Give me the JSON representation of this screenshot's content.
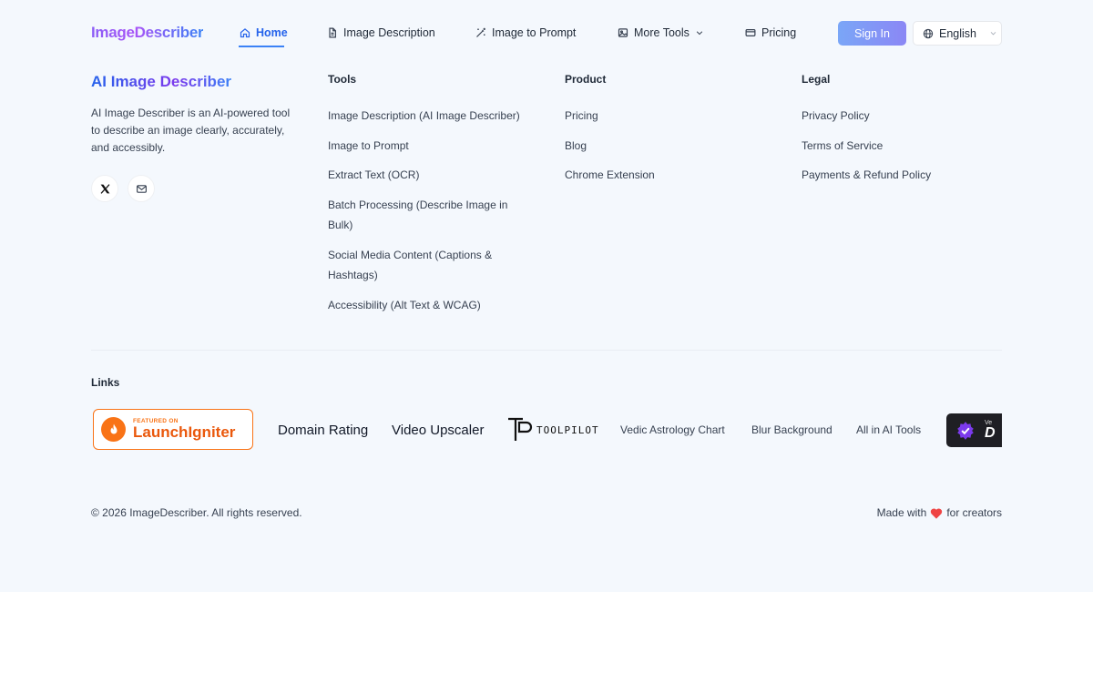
{
  "header": {
    "logo": "ImageDescriber",
    "nav": [
      {
        "label": "Home",
        "icon": "home-icon",
        "active": true
      },
      {
        "label": "Image Description",
        "icon": "document-icon"
      },
      {
        "label": "Image to Prompt",
        "icon": "magic-wand-icon"
      },
      {
        "label": "More Tools",
        "icon": "image-icon"
      },
      {
        "label": "Pricing",
        "icon": "credit-card-icon"
      }
    ],
    "sign_in": "Sign In",
    "language": "English"
  },
  "brand": {
    "title": "AI Image Describer",
    "description": "AI Image Describer is an AI-powered tool to describe an image clearly, accurately, and accessibly."
  },
  "columns": {
    "tools": {
      "title": "Tools",
      "links": [
        "Image Description (AI Image Describer)",
        "Image to Prompt",
        "Extract Text (OCR)",
        "Batch Processing (Describe Image in Bulk)",
        "Social Media Content (Captions & Hashtags)",
        "Accessibility (Alt Text & WCAG)"
      ]
    },
    "product": {
      "title": "Product",
      "links": [
        "Pricing",
        "Blog",
        "Chrome Extension"
      ]
    },
    "legal": {
      "title": "Legal",
      "links": [
        "Privacy Policy",
        "Terms of Service",
        "Payments & Refund Policy"
      ]
    }
  },
  "links": {
    "title": "Links",
    "launchigniter_small": "FEATURED ON",
    "launchigniter_big": "LaunchIgniter",
    "domain_rating": "Domain Rating",
    "video_upscaler": "Video Upscaler",
    "toolpilot": "TOOLPILOT",
    "vedic": "Vedic Astrology Chart",
    "blur": "Blur Background",
    "all_ai": "All in AI Tools",
    "dark_small": "Ve",
    "dark_big": "D"
  },
  "footer": {
    "copyright": "© 2026 ImageDescriber. All rights reserved.",
    "made_with_prefix": "Made with",
    "made_with_suffix": "for creators"
  },
  "colors": {
    "accent": "#3b82f6",
    "background": "#f4f8fd",
    "launchigniter": "#f97316"
  }
}
